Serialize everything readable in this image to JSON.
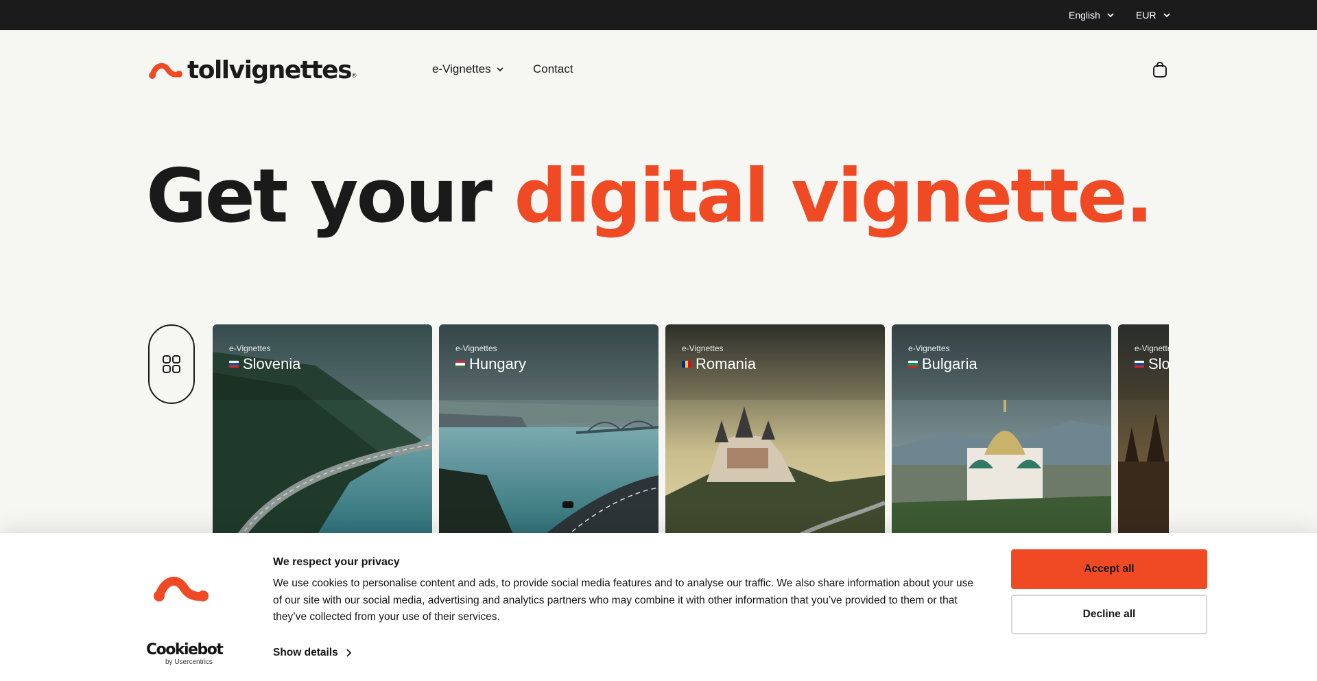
{
  "topbar": {
    "language": "English",
    "currency": "EUR"
  },
  "header": {
    "logo_text": "tollvignettes",
    "logo_reg": "®",
    "nav": {
      "vignettes_label": "e-Vignettes",
      "contact_label": "Contact"
    }
  },
  "hero": {
    "line_plain": "Get your ",
    "line_accent": "digital vignette."
  },
  "cards": [
    {
      "kicker": "e-Vignettes",
      "country": "Slovenia",
      "flag_colors": [
        "#ffffff",
        "#1c4fa0",
        "#e1261c"
      ]
    },
    {
      "kicker": "e-Vignettes",
      "country": "Hungary",
      "flag_colors": [
        "#cd2a3e",
        "#ffffff",
        "#436f4d"
      ]
    },
    {
      "kicker": "e-Vignettes",
      "country": "Romania",
      "flag_colors": [
        "#002b7f",
        "#fcd116",
        "#ce1126"
      ]
    },
    {
      "kicker": "e-Vignettes",
      "country": "Bulgaria",
      "flag_colors": [
        "#ffffff",
        "#00966e",
        "#d62612"
      ]
    },
    {
      "kicker": "e-Vignettes",
      "country": "Slovakia",
      "flag_colors": [
        "#ffffff",
        "#0b4ea2",
        "#ee1c25"
      ]
    }
  ],
  "cookie": {
    "heading": "We respect your privacy",
    "body": "We use cookies to personalise content and ads, to provide social media features and to analyse our traffic. We also share information about your use of our site with our social media, advertising and analytics partners who may combine it with other information that you’ve provided to them or that they’ve collected from your use of their services.",
    "show_details": "Show details",
    "accept_label": "Accept all",
    "decline_label": "Decline all",
    "brand": "Cookiebot",
    "brand_sub": "by Usercentrics"
  },
  "colors": {
    "accent": "#f04a25",
    "topbar": "#1b1b1b",
    "background": "#f6f6f3"
  },
  "icons": [
    "chevron-down-icon",
    "cart-icon",
    "grid-icon",
    "logo-mark-icon",
    "chevron-right-icon"
  ]
}
